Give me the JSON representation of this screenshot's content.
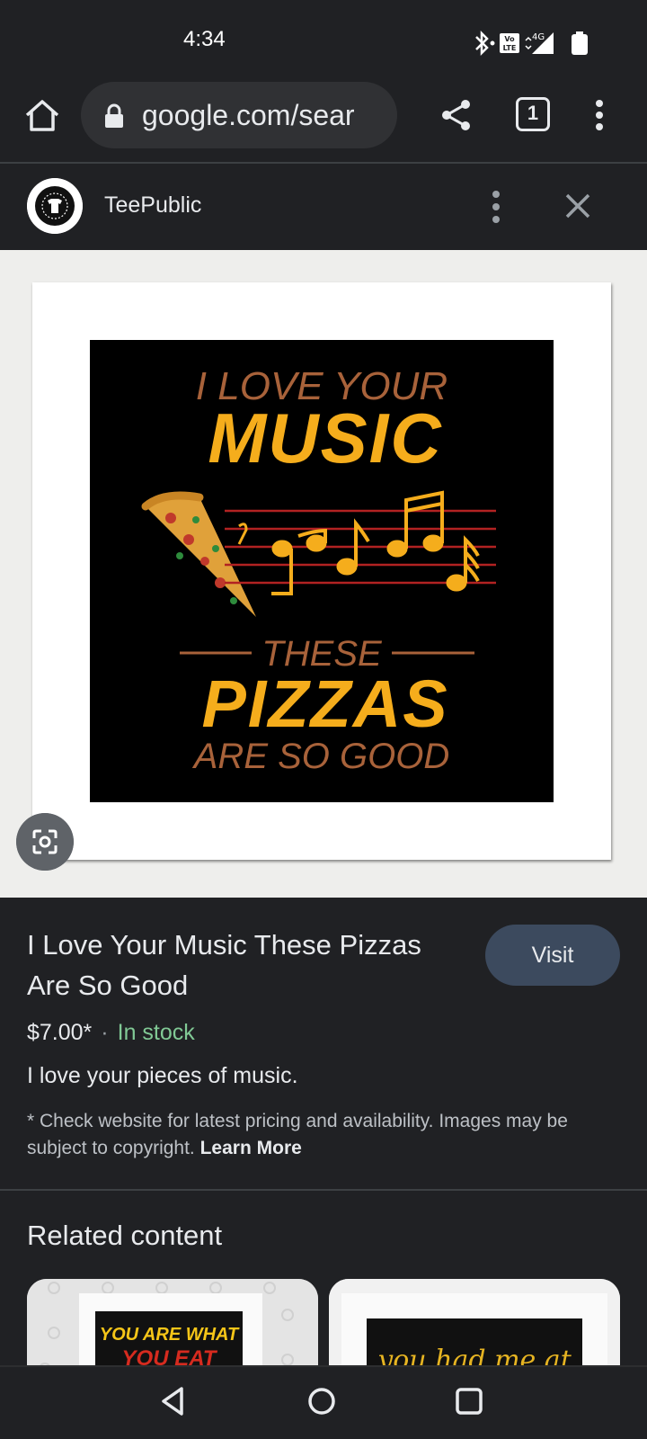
{
  "status_bar": {
    "time": "4:34",
    "icons": [
      "bluetooth-icon",
      "volte-icon",
      "4g-icon",
      "signal-icon",
      "battery-icon"
    ],
    "network": "4G",
    "volte_label": "VoLTE"
  },
  "browser": {
    "url": "google.com/sear",
    "tab_count": "1"
  },
  "source": {
    "name": "TeePublic"
  },
  "artwork": {
    "line1": "I LOVE YOUR",
    "line2": "MUSIC",
    "line3": "THESE",
    "line4": "PIZZAS",
    "line5": "ARE SO GOOD",
    "colors": {
      "accent": "#f5ad1c",
      "brown": "#a8623a",
      "staff": "#b22222"
    }
  },
  "product": {
    "title": "I Love Your Music These Pizzas Are So Good",
    "visit_label": "Visit",
    "price": "$7.00*",
    "separator": "·",
    "stock": "In stock",
    "description": "I love your pieces of music.",
    "disclaimer": "* Check website for latest pricing and availability. Images may be subject to copyright.",
    "learn_more": "Learn More"
  },
  "related": {
    "heading": "Related content",
    "cards": [
      {
        "text_line1": "YOU ARE WHAT",
        "text_line2": "YOU EAT"
      },
      {
        "text": "you had me at"
      }
    ]
  },
  "colors": {
    "background": "#202124",
    "stock_green": "#81c995",
    "visit_button": "#3c4a5e"
  }
}
